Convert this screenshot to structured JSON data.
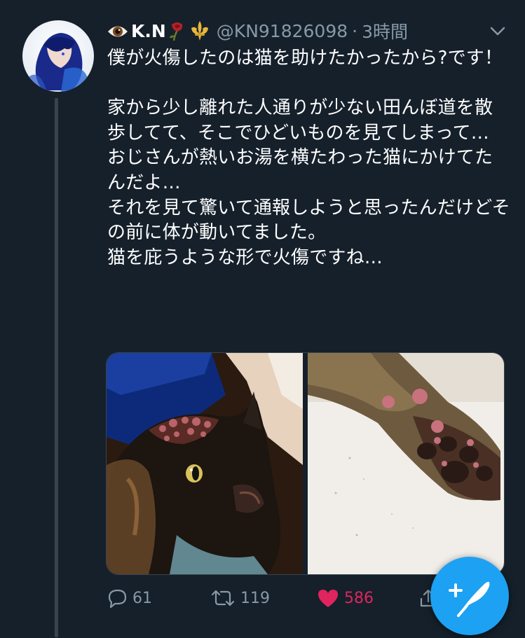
{
  "tweet": {
    "display_name": "K.N",
    "handle": "@KN91826098",
    "separator": "·",
    "time": "3時間",
    "text": "僕が火傷したのは猫を助けたかったから?です！\n\n家から少し離れた人通りが少ない田んぼ道を散歩してて、そこでひどいものを見てしまって…\nおじさんが熱いお湯を横たわった猫にかけてたんだよ…\nそれを見て驚いて通報しようと思ったんだけどその前に体が動いてました。\n猫を庇うような形で火傷ですね…"
  },
  "actions": {
    "reply_count": "61",
    "retweet_count": "119",
    "like_count": "586"
  },
  "colors": {
    "background": "#15202b",
    "secondary_text": "#8899a6",
    "like": "#e0245e",
    "accent": "#1da1f2"
  },
  "icons": [
    "eye-emoji-icon",
    "wilted-rose-emoji-icon",
    "fleur-de-lis-emoji-icon",
    "chevron-down-icon",
    "reply-icon",
    "retweet-icon",
    "heart-icon",
    "share-icon",
    "compose-tweet-icon"
  ]
}
